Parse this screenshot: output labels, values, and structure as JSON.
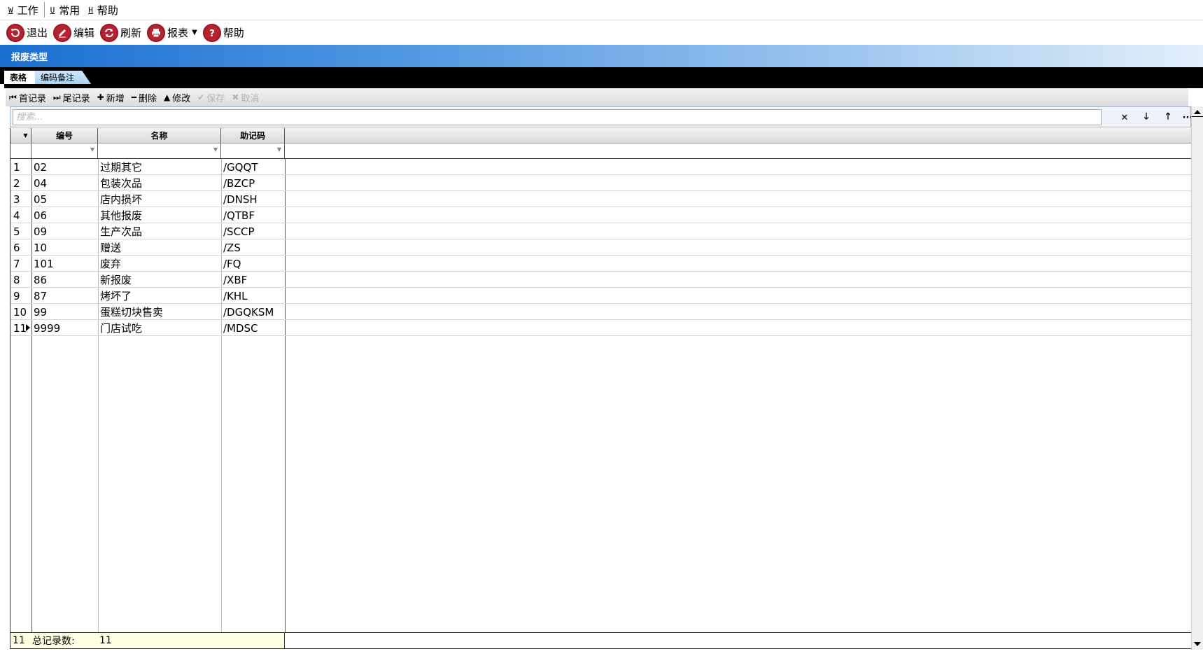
{
  "menu": [
    {
      "hotkey": "W",
      "label": "工作"
    },
    {
      "hotkey": "U",
      "label": "常用"
    },
    {
      "hotkey": "H",
      "label": "帮助"
    }
  ],
  "toolbar": {
    "exit_label": "退出",
    "edit_label": "编辑",
    "refresh_label": "刷新",
    "report_label": "报表",
    "help_label": "帮助",
    "icon_color": "#b4232f"
  },
  "title": "报废类型",
  "tabs": [
    {
      "label": "表格",
      "active": true
    },
    {
      "label": "编码备注",
      "active": false
    }
  ],
  "subtoolbar": {
    "first_label": "首记录",
    "last_label": "尾记录",
    "add_label": "新增",
    "delete_label": "删除",
    "modify_label": "修改",
    "save_label": "保存",
    "cancel_label": "取消"
  },
  "search": {
    "placeholder": "搜索...",
    "clear_icon": "close-icon",
    "down_icon": "arrow-down-icon",
    "up_icon": "arrow-up-icon",
    "more_icon": "ellipsis-icon"
  },
  "grid": {
    "columns": [
      "编号",
      "名称",
      "助记码"
    ],
    "rows": [
      {
        "n": "1",
        "code": "02",
        "name": "过期其它",
        "mnemonic": "/GQQT"
      },
      {
        "n": "2",
        "code": "04",
        "name": "包装次品",
        "mnemonic": "/BZCP"
      },
      {
        "n": "3",
        "code": "05",
        "name": "店内损坏",
        "mnemonic": "/DNSH"
      },
      {
        "n": "4",
        "code": "06",
        "name": "其他报废",
        "mnemonic": "/QTBF"
      },
      {
        "n": "5",
        "code": "09",
        "name": "生产次品",
        "mnemonic": "/SCCP"
      },
      {
        "n": "6",
        "code": "10",
        "name": "赠送",
        "mnemonic": "/ZS"
      },
      {
        "n": "7",
        "code": "101",
        "name": "废弃",
        "mnemonic": "/FQ"
      },
      {
        "n": "8",
        "code": "86",
        "name": "新报废",
        "mnemonic": "/XBF"
      },
      {
        "n": "9",
        "code": "87",
        "name": "烤坏了",
        "mnemonic": "/KHL"
      },
      {
        "n": "10",
        "code": "99",
        "name": "蛋糕切块售卖",
        "mnemonic": "/DGQKSM"
      },
      {
        "n": "11",
        "code": "9999",
        "name": "门店试吃",
        "mnemonic": "/MDSC",
        "current": true
      }
    ]
  },
  "footer": {
    "count": "11",
    "total_label": "总记录数:",
    "total_value": "11"
  }
}
